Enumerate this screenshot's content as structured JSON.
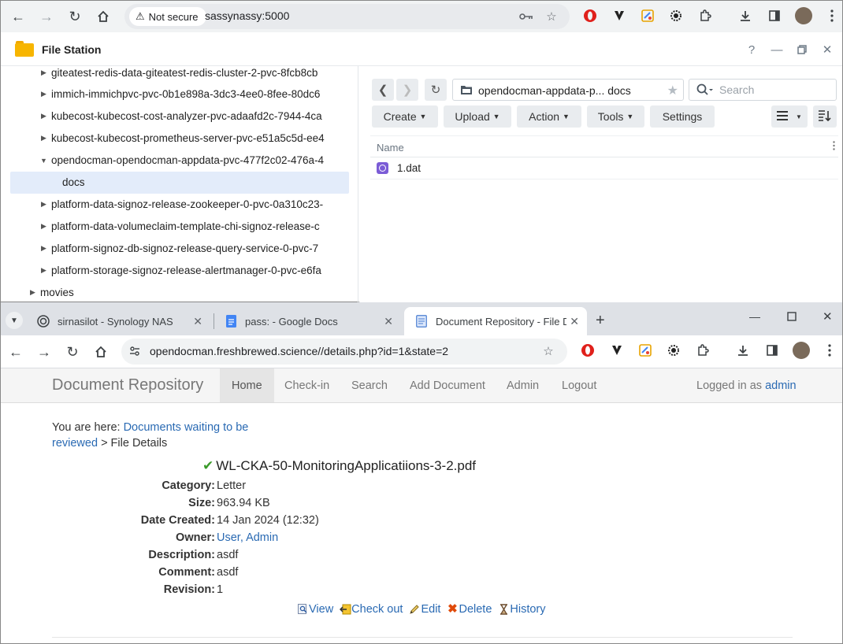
{
  "browser1": {
    "not_secure_label": "Not secure",
    "url": "sassynassy:5000"
  },
  "file_station": {
    "title": "File Station",
    "tree": [
      {
        "label": "giteatest-redis-data-giteatest-redis-cluster-2-pvc-8fcb8cb",
        "expanded": false
      },
      {
        "label": "immich-immichpvc-pvc-0b1e898a-3dc3-4ee0-8fee-80dc6",
        "expanded": false
      },
      {
        "label": "kubecost-kubecost-cost-analyzer-pvc-adaafd2c-7944-4ca",
        "expanded": false
      },
      {
        "label": "kubecost-kubecost-prometheus-server-pvc-e51a5c5d-ee4",
        "expanded": false
      },
      {
        "label": "opendocman-opendocman-appdata-pvc-477f2c02-476a-4",
        "expanded": true
      },
      {
        "label": "docs",
        "selected": true
      },
      {
        "label": "platform-data-signoz-release-zookeeper-0-pvc-0a310c23-",
        "expanded": false
      },
      {
        "label": "platform-data-volumeclaim-template-chi-signoz-release-c",
        "expanded": false
      },
      {
        "label": "platform-signoz-db-signoz-release-query-service-0-pvc-7",
        "expanded": false
      },
      {
        "label": "platform-storage-signoz-release-alertmanager-0-pvc-e6fa",
        "expanded": false
      },
      {
        "label": "movies",
        "expanded": false
      }
    ],
    "path": "opendocman-appdata-p... docs",
    "search_placeholder": "Search",
    "buttons": {
      "create": "Create",
      "upload": "Upload",
      "action": "Action",
      "tools": "Tools",
      "settings": "Settings"
    },
    "column_name": "Name",
    "files": [
      {
        "name": "1.dat"
      }
    ]
  },
  "browser2": {
    "tabs": [
      {
        "title": "sirnasilot - Synology NAS"
      },
      {
        "title": "pass: - Google Docs"
      },
      {
        "title": "Document Repository - File Det"
      }
    ],
    "url": "opendocman.freshbrewed.science//details.php?id=1&state=2"
  },
  "app": {
    "brand": "Document Repository",
    "nav": [
      "Home",
      "Check-in",
      "Search",
      "Add Document",
      "Admin",
      "Logout"
    ],
    "logged_prefix": "Logged in as",
    "logged_user": "admin",
    "breadcrumb_prefix": "You are here:",
    "breadcrumb_link": "Documents waiting to be reviewed",
    "breadcrumb_current": "> File Details",
    "file_title": "WL-CKA-50-MonitoringApplicatiions-3-2.pdf",
    "fields": [
      {
        "label": "Category:",
        "value": "Letter"
      },
      {
        "label": "Size:",
        "value": "963.94 KB"
      },
      {
        "label": "Date Created:",
        "value": "14 Jan 2024 (12:32)"
      },
      {
        "label": "Owner:",
        "value": "User, Admin",
        "link": true
      },
      {
        "label": "Description:",
        "value": "asdf"
      },
      {
        "label": "Comment:",
        "value": "asdf"
      },
      {
        "label": "Revision:",
        "value": "1"
      }
    ],
    "actions": {
      "view": "View",
      "checkout": "Check out",
      "edit": "Edit",
      "delete": "Delete",
      "history": "History"
    }
  }
}
